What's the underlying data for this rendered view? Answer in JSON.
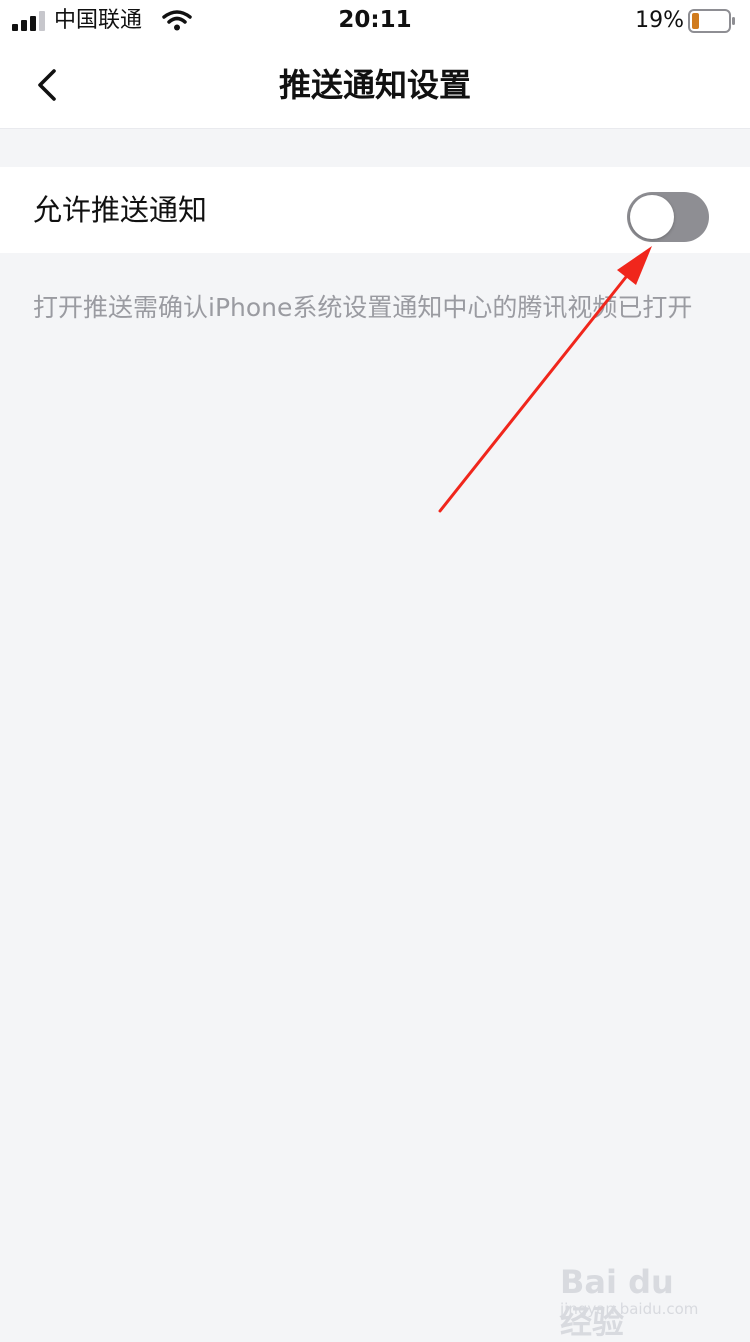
{
  "status_bar": {
    "carrier": "中国联通",
    "time": "20:11",
    "battery_percent": "19%",
    "battery_level": 0.19,
    "battery_color": "#d07b1d",
    "icons": [
      "signal-icon",
      "wifi-icon",
      "battery-icon"
    ]
  },
  "nav": {
    "back_icon": "chevron-left-icon",
    "title": "推送通知设置"
  },
  "setting": {
    "label": "允许推送通知",
    "enabled": false,
    "toggle_off_color": "#8e8e93"
  },
  "hint": {
    "text": "打开推送需确认iPhone系统设置通知中心的腾讯视频已打开"
  },
  "annotation": {
    "arrow_color": "#f0261c"
  },
  "watermark": {
    "logo": "Bai du 经验",
    "sub": "jingyan.baidu.com"
  }
}
